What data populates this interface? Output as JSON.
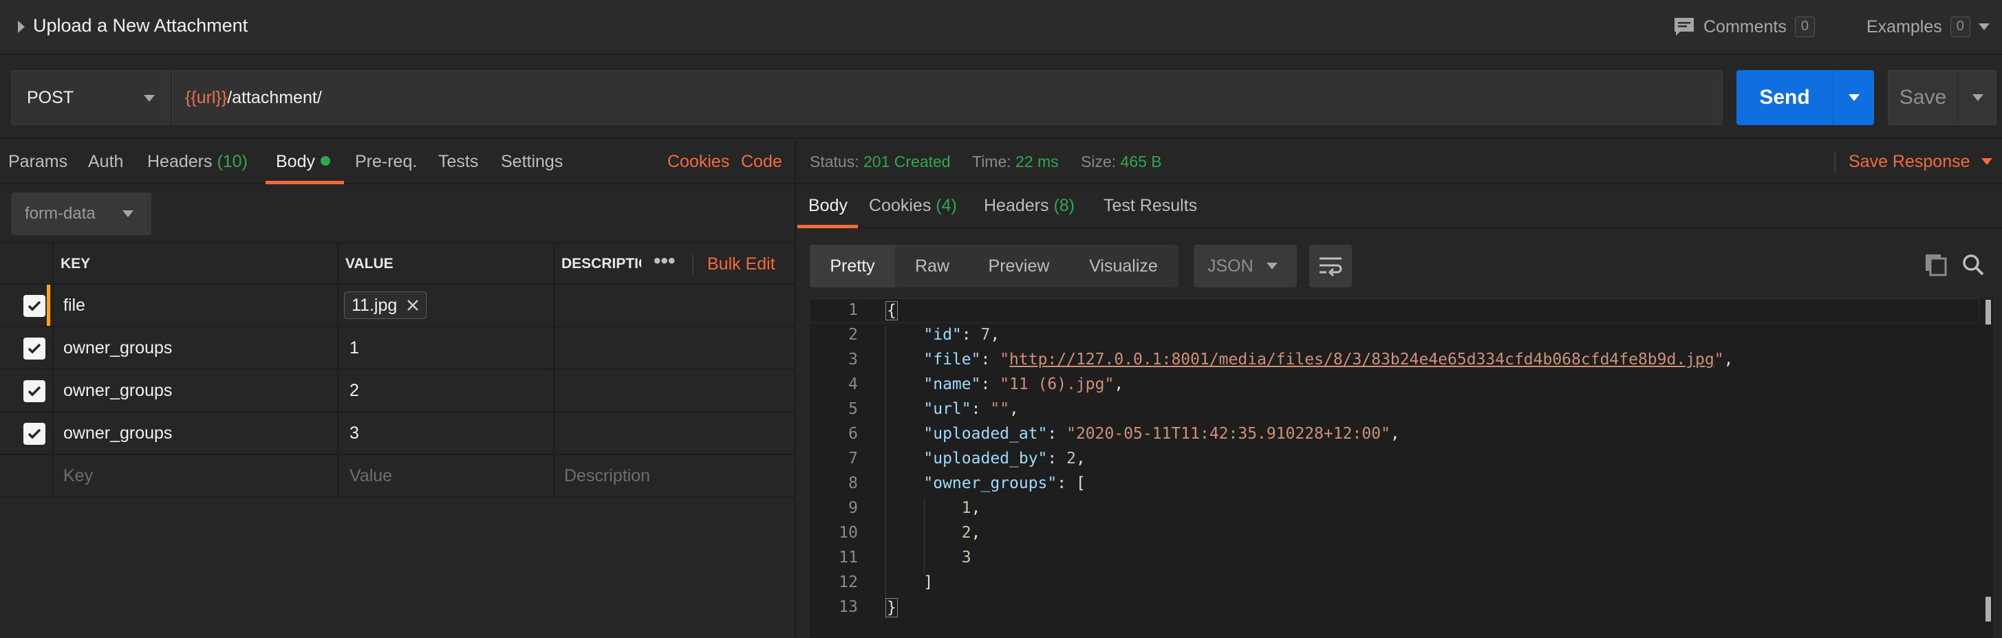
{
  "title": "Upload a New Attachment",
  "header": {
    "comments_label": "Comments",
    "comments_count": "0",
    "examples_label": "Examples",
    "examples_count": "0"
  },
  "request": {
    "method": "POST",
    "url_var": "{{url}}",
    "url_path": "/attachment/",
    "send_label": "Send",
    "save_label": "Save"
  },
  "request_tabs": {
    "params": "Params",
    "auth": "Auth",
    "headers": "Headers",
    "headers_count": "(10)",
    "body": "Body",
    "prereq": "Pre-req.",
    "tests": "Tests",
    "settings": "Settings",
    "cookies": "Cookies",
    "code": "Code"
  },
  "body": {
    "type": "form-data",
    "columns": {
      "key": "KEY",
      "value": "VALUE",
      "description": "DESCRIPTIO",
      "bulk_edit": "Bulk Edit"
    },
    "rows": [
      {
        "key": "file",
        "value": "11.jpg",
        "checked": true,
        "is_file": true
      },
      {
        "key": "owner_groups",
        "value": "1",
        "checked": true
      },
      {
        "key": "owner_groups",
        "value": "2",
        "checked": true
      },
      {
        "key": "owner_groups",
        "value": "3",
        "checked": true
      }
    ],
    "placeholders": {
      "key": "Key",
      "value": "Value",
      "description": "Description"
    }
  },
  "response": {
    "status_label": "Status:",
    "status_value": "201 Created",
    "time_label": "Time:",
    "time_value": "22 ms",
    "size_label": "Size:",
    "size_value": "465 B",
    "save_response": "Save Response",
    "tabs": {
      "body": "Body",
      "cookies": "Cookies",
      "cookies_count": "(4)",
      "headers": "Headers",
      "headers_count": "(8)",
      "tests": "Test Results"
    },
    "views": {
      "pretty": "Pretty",
      "raw": "Raw",
      "preview": "Preview",
      "visualize": "Visualize"
    },
    "format": "JSON",
    "line_numbers": [
      "1",
      "2",
      "3",
      "4",
      "5",
      "6",
      "7",
      "8",
      "9",
      "10",
      "11",
      "12",
      "13"
    ],
    "json": {
      "open_brace": "{",
      "id_key": "\"id\"",
      "id_val": "7",
      "file_key": "\"file\"",
      "file_val": "http://127.0.0.1:8001/media/files/8/3/83b24e4e65d334cfd4b068cfd4fe8b9d.jpg",
      "name_key": "\"name\"",
      "name_val": "\"11 (6).jpg\"",
      "url_key": "\"url\"",
      "url_val": "\"\"",
      "uploaded_at_key": "\"uploaded_at\"",
      "uploaded_at_val": "\"2020-05-11T11:42:35.910228+12:00\"",
      "uploaded_by_key": "\"uploaded_by\"",
      "uploaded_by_val": "2",
      "owner_groups_key": "\"owner_groups\"",
      "group1": "1",
      "group2": "2",
      "group3": "3",
      "close_bracket": "]",
      "close_brace": "}"
    }
  },
  "colors": {
    "accent": "#f26b3a",
    "send": "#0f6fe0",
    "success": "#2fa84f"
  }
}
